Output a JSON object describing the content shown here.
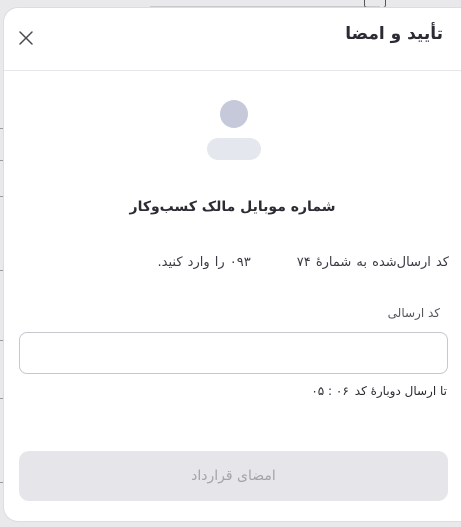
{
  "modal": {
    "title": "تأیید و امضا",
    "heading": "شماره موبایل مالک کسب‌وکار",
    "instruction_prefix": "کد ارسال‌شده به شمارهٔ ۷۴",
    "instruction_suffix": "۰۹۳ را وارد کنید.",
    "field_label": "کد ارسالی",
    "input_value": "",
    "input_placeholder": "",
    "resend_text": "تا ارسال دوبارهٔ کد",
    "resend_timer": "۰۶ : ۰۵",
    "submit_label": "امضای قرارداد"
  },
  "colors": {
    "avatar": "#c5c9d9",
    "avatar_body": "#e5e7ef",
    "button_bg": "#e6e6ea",
    "button_text": "#a3a3ab",
    "border": "#c7c7cf"
  },
  "icons": {
    "close": "close-icon",
    "avatar": "user-avatar-icon"
  }
}
